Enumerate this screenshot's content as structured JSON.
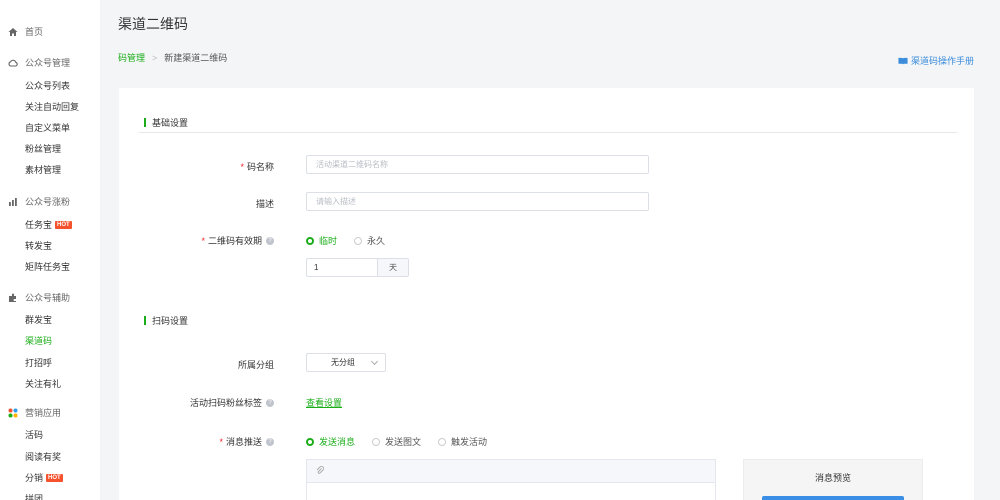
{
  "sidebar": {
    "home": {
      "label": "首页",
      "icon": "home-icon"
    },
    "groups": [
      {
        "label": "公众号管理",
        "icon": "cloud-icon",
        "items": [
          {
            "label": "公众号列表"
          },
          {
            "label": "关注自动回复"
          },
          {
            "label": "自定义菜单"
          },
          {
            "label": "粉丝管理"
          },
          {
            "label": "素材管理"
          }
        ]
      },
      {
        "label": "公众号涨粉",
        "icon": "chart-icon",
        "items": [
          {
            "label": "任务宝",
            "badge": "HOT"
          },
          {
            "label": "转发宝"
          },
          {
            "label": "矩阵任务宝"
          }
        ]
      },
      {
        "label": "公众号辅助",
        "icon": "plugin-icon",
        "items": [
          {
            "label": "群发宝"
          },
          {
            "label": "渠道码",
            "active": true
          },
          {
            "label": "打招呼"
          },
          {
            "label": "关注有礼"
          }
        ]
      },
      {
        "label": "营销应用",
        "icon": "apps-icon",
        "items": [
          {
            "label": "活码"
          },
          {
            "label": "阅读有奖"
          },
          {
            "label": "分销",
            "badge": "HOT"
          },
          {
            "label": "拼团"
          }
        ]
      }
    ]
  },
  "header": {
    "title": "渠道二维码",
    "breadcrumb": {
      "parent": "码管理",
      "separator": ">",
      "current": "新建渠道二维码"
    },
    "manual_link": "渠道码操作手册"
  },
  "form": {
    "basic_section": "基础设置",
    "code_name": {
      "label": "码名称",
      "required": "*",
      "placeholder": "活动渠道二维码名称",
      "value": ""
    },
    "description": {
      "label": "描述",
      "placeholder": "请输入描述",
      "value": ""
    },
    "validity": {
      "label": "二维码有效期",
      "required": "*",
      "options": [
        "临时",
        "永久"
      ],
      "selected": "临时"
    },
    "validity_days": {
      "value": "1",
      "unit": "天"
    },
    "scan_section": "扫码设置",
    "group": {
      "label": "所属分组",
      "selected": "无分组"
    },
    "fan_tag": {
      "label": "活动扫码粉丝标签",
      "link": "查看设置"
    },
    "push": {
      "label": "消息推送",
      "required": "*",
      "options": [
        "发送消息",
        "发送图文",
        "触发活动"
      ],
      "selected": "发送消息"
    },
    "preview_title": "消息预览"
  },
  "colors": {
    "accent": "#1aad19",
    "link": "#3b8ddb",
    "required": "#f5222d",
    "hot": "#f5522d"
  }
}
